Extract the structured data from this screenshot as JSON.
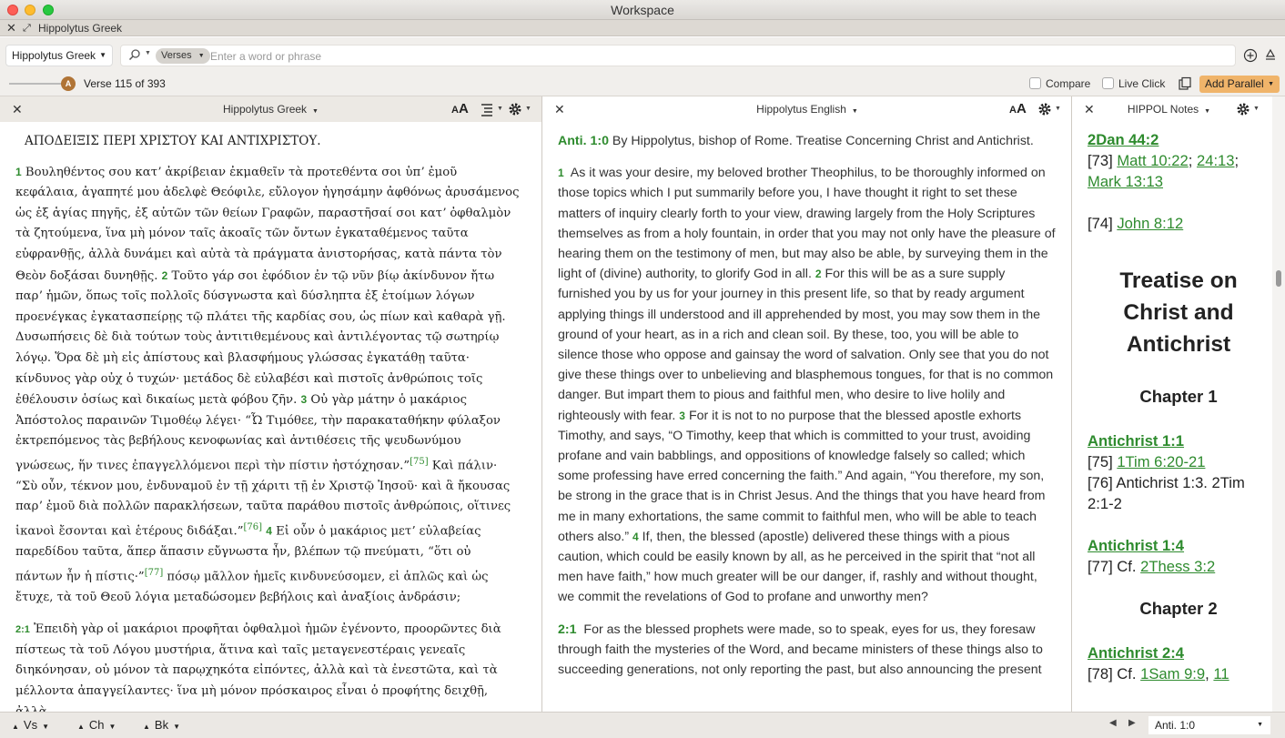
{
  "window": {
    "title": "Workspace"
  },
  "tab": {
    "close": "✕",
    "fullscreen": "⤢",
    "name": "Hippolytus Greek"
  },
  "search": {
    "resource": "Hippolytus Greek",
    "scope": "Verses",
    "placeholder": "Enter a word or phrase",
    "value": ""
  },
  "toolbar": {
    "slider_letter": "A",
    "verse_position": "Verse 115 of 393",
    "compare_label": "Compare",
    "compare_checked": false,
    "live_click_label": "Live Click",
    "live_click_checked": false,
    "add_parallel_label": "Add Parallel"
  },
  "greek_panel": {
    "title": "Hippolytus Greek",
    "heading": "ΑΠΟΔΕΙΞΙΣ ΠΕΡΙ ΧΡΙΣΤΟΥ ΚΑΙ ΑΝΤΙΧΡΙΣΤΟΥ.",
    "p1": {
      "v1": "1",
      "t1": "Βουληθέντος σου κατʼ ἀκρίβειαν ἐκμαθεῖν τὰ προτεθέντα σοι ὑπʼ ἐμοῦ κεφάλαια, ἀγαπητέ μου ἀδελφὲ Θεόφιλε, εὔλογον ἡγησάμην ἀφθόνως ἀρυσάμενος ὡς ἐξ ἁγίας πηγῆς, ἐξ αὐτῶν τῶν θείων Γραφῶν, παραστῆσαί σοι κατʼ ὀφθαλμὸν τὰ ζητούμενα, ἵνα μὴ μόνον ταῖς ἀκοαῖς τῶν ὄντων ἐγκαταθέμενος ταῦτα εὐφρανθῇς, ἀλλὰ δυνάμει καὶ αὐτὰ τὰ πράγματα ἀνιστορήσας, κατὰ πάντα τὸν Θεὸν δοξάσαι δυνηθῇς.",
      "v2": "2",
      "t2": "Τοῦτο γάρ σοι ἐφόδιον ἐν τῷ νῦν βίῳ ἀκίνδυνον ἤτω παρʼ ἡμῶν, ὅπως τοῖς πολλοῖς δύσγνωστα καὶ δύσληπτα ἐξ ἑτοίμων λόγων προενέγκας ἐγκατασπείρῃς τῷ πλάτει τῆς καρδίας σου, ὡς πίων καὶ καθαρὰ γῇ. Δυσωπήσεις δὲ διὰ τούτων τοὺς ἀντιτιθεμένους καὶ ἀντιλέγοντας τῷ σωτηρίῳ λόγῳ. Ὅρα δὲ μὴ εἰς ἀπίστους καὶ βλασφήμους γλώσσας ἐγκατάθῃ ταῦτα· κίνδυνος γὰρ οὐχ ὁ τυχών· μετάδος δὲ εὐλαβέσι καὶ πιστοῖς ἀνθρώποις τοῖς ἐθέλουσιν ὁσίως καὶ δικαίως μετὰ φόβου ζῆν.",
      "v3": "3",
      "t3": "Οὐ γὰρ μάτην ὁ μακάριος Ἀπόστολος παραινῶν Τιμοθέῳ λέγει· “Ὦ Τιμόθεε, τὴν παρακαταθήκην φύλαξον ἐκτρεπόμενος τὰς βεβήλους κενοφωνίας καὶ ἀντιθέσεις τῆς ψευδωνύμου γνώσεως, ἥν τινες ἐπαγγελλόμενοι περὶ τὴν πίστιν ἠστόχησαν.”",
      "n75": "[75]",
      "t4": "Καὶ πάλιν· “Σὺ οὖν, τέκνον μου, ἐνδυναμοῦ ἐν τῇ χάριτι τῇ ἐν Χριστῷ Ἰησοῦ· καὶ ἃ ἤκουσας παρʼ ἐμοῦ διὰ πολλῶν παρακλήσεων, ταῦτα παράθου πιστοῖς ἀνθρώποις, οἵτινες ἱκανοὶ ἔσονται καὶ ἑτέρους διδάξαι.”",
      "n76": "[76]",
      "v4": "4",
      "t5": "Εἰ οὖν ὁ μακάριος μετʼ εὐλαβείας παρεδίδου ταῦτα, ἅπερ ἅπασιν εὔγνωστα ἦν, βλέπων τῷ πνεύματι, “ὅτι οὐ πάντων ἦν ἡ πίστις·”",
      "n77": "[77]",
      "t6": "πόσῳ μᾶλλον ἡμεῖς κινδυνεύσομεν, εἰ ἁπλῶς καὶ ὡς ἔτυχε, τὰ τοῦ Θεοῦ λόγια μεταδώσομεν βεβήλοις καὶ ἀναξίοις ἀνδράσιν;"
    },
    "p2": {
      "ref": "2:1",
      "text": "Ἐπειδὴ γὰρ οἱ μακάριοι προφῆται ὀφθαλμοὶ ἡμῶν ἐγένοντο, προορῶντες διὰ πίστεως τὰ τοῦ Λόγου μυστήρια, ἅτινα καὶ ταῖς μεταγενεστέραις γενεαῖς διηκόνησαν, οὐ μόνον τὰ παρῳχηκότα εἰπόντες, ἀλλὰ καὶ τὰ ἐνεστῶτα, καὶ τὰ μέλλοντα ἀπαγγείλαντες· ἵνα μὴ μόνον πρόσκαιρος εἶναι ὁ προφήτης δειχθῇ, ἀλλὰ"
    }
  },
  "english_panel": {
    "title": "Hippolytus English",
    "p0": {
      "ref": "Anti. 1:0",
      "text": "By Hippolytus, bishop of Rome. Treatise Concerning Christ and Antichrist."
    },
    "p1": {
      "v1": "1",
      "t1": "As it was your desire, my beloved brother Theophilus, to be thoroughly informed on those topics which I put summarily before you, I have thought it right to set these matters of inquiry clearly forth to your view, drawing largely from the Holy Scriptures themselves as from a holy fountain, in order that you may not only have the pleasure of hearing them on the testimony of men, but may also be able, by surveying them in the light of (divine) authority, to glorify God in all.",
      "v2": "2",
      "t2": "For this will be as a sure supply furnished you by us for your journey in this present life, so that by ready argument applying things ill understood and ill apprehended by most, you may sow them in the ground of your heart, as in a rich and clean soil. By these, too, you will be able to silence those who oppose and gainsay the word of salvation. Only see that you do not give these things over to unbelieving and blasphemous tongues, for that is no common danger. But impart them to pious and faithful men, who desire to live holily and righteously with fear.",
      "v3": "3",
      "t3": "For it is not to no purpose that the blessed apostle exhorts Timothy, and says, “O Timothy, keep that which is committed to your trust, avoiding profane and vain babblings, and oppositions of knowledge falsely so called; which some professing have erred concerning the faith.” And again, “You therefore, my son, be strong in the grace that is in Christ Jesus. And the things that you have heard from me in many exhortations, the same commit to faithful men, who will be able to teach others also.”",
      "v4": "4",
      "t4": "If, then, the blessed (apostle) delivered these things with a pious caution, which could be easily known by all, as he perceived in the spirit that “not all men have faith,” how much greater will be our danger, if, rashly and without thought, we commit the revelations of God to profane and unworthy men?"
    },
    "p2": {
      "ref": "2:1",
      "text": "For as the blessed prophets were made, so to speak, eyes for us, they foresaw through faith the mysteries of the Word, and became ministers of these things also to succeeding generations, not only reporting the past, but also announcing the present"
    }
  },
  "notes_panel": {
    "title": "HIPPOL Notes",
    "top_ref": "2Dan 44:2",
    "n73": "[73]",
    "n73_link1": "Matt 10:22",
    "n73_sep": ";",
    "n73_link2": "24:13",
    "n73_sep2": ";",
    "n73_link3": "Mark 13:13",
    "n74": "[74]",
    "n74_link": "John 8:12",
    "big_title": "Treatise on Christ and Antichrist",
    "chapter1": "Chapter 1",
    "ref1": "Antichrist 1:1",
    "n75": "[75]",
    "n75_link": "1Tim 6:20-21",
    "n76": "[76]",
    "n76_text": "Antichrist 1:3. 2Tim 2:1-2",
    "ref2": "Antichrist 1:4",
    "n77": "[77] Cf.",
    "n77_link": "2Thess 3:2",
    "chapter2": "Chapter 2",
    "ref3": "Antichrist 2:4",
    "n78": "[78] Cf.",
    "n78_link": "1Sam 9:9",
    "n78_sep": ",",
    "n78_link2": "11"
  },
  "bottom": {
    "vs": "Vs",
    "ch": "Ch",
    "bk": "Bk",
    "prev": "◀",
    "next": "▶",
    "reference": "Anti. 1:0"
  },
  "colors": {
    "accent_green": "#2e8b2e",
    "add_parallel_bg": "#f0b46a",
    "slider_knob": "#b07436"
  }
}
